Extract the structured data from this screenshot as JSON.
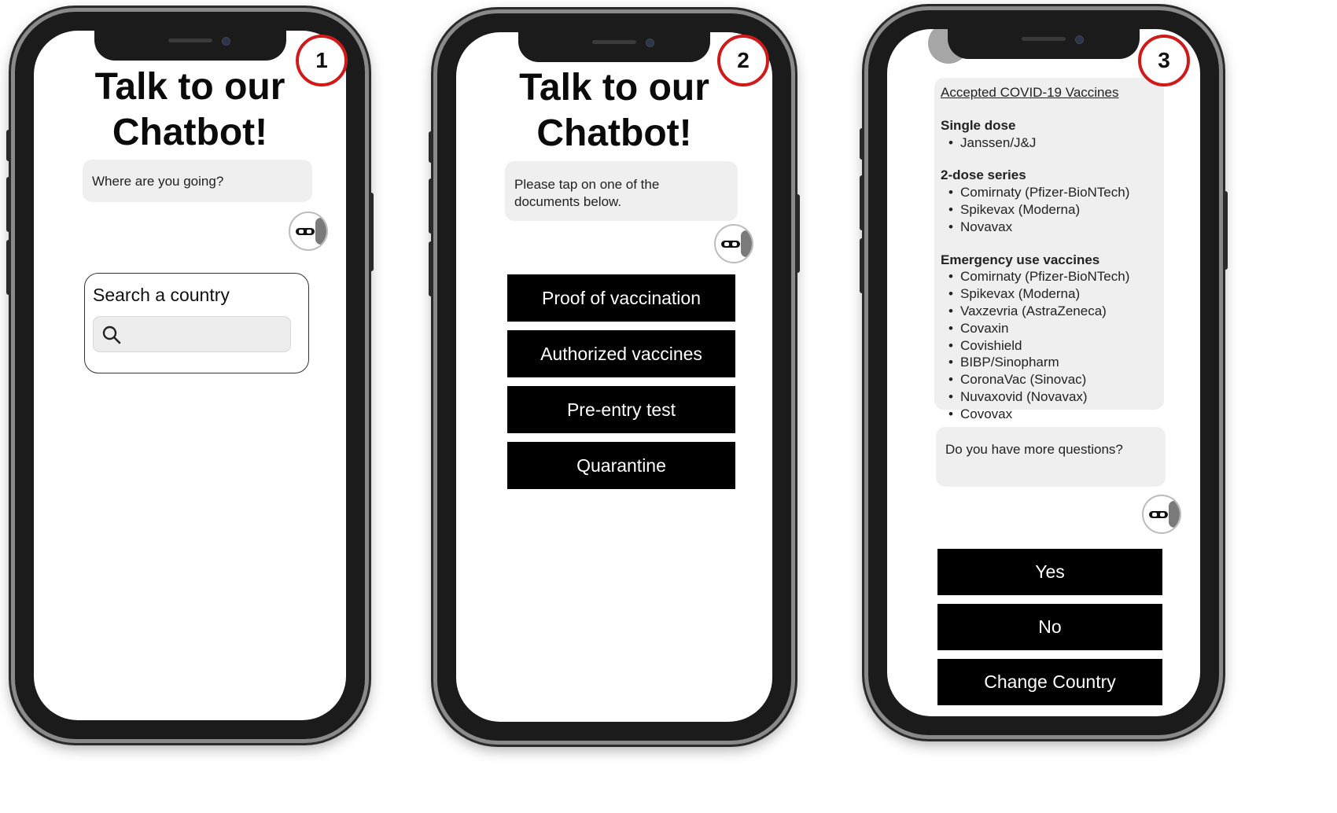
{
  "screens": [
    {
      "step_number": "1",
      "title_line1": "Talk to our",
      "title_line2": "Chatbot!",
      "bot_message": "Where are you going?",
      "search_label": "Search a country",
      "search_placeholder": "",
      "search_icon": "search-icon"
    },
    {
      "step_number": "2",
      "title_line1": "Talk to our",
      "title_line2": "Chatbot!",
      "bot_message": "Please tap on one of the documents below.",
      "options": [
        "Proof of vaccination",
        "Authorized vaccines",
        "Pre-entry test",
        "Quarantine"
      ]
    },
    {
      "step_number": "3",
      "vaccines_heading": "Accepted COVID-19 Vaccines",
      "sections": [
        {
          "title": "Single dose",
          "items": [
            "Janssen/J&J"
          ]
        },
        {
          "title": "2-dose series",
          "items": [
            "Comirnaty (Pfizer-BioNTech)",
            "Spikevax (Moderna)",
            "Novavax"
          ]
        },
        {
          "title": "Emergency use vaccines",
          "items": [
            "Comirnaty (Pfizer-BioNTech)",
            "Spikevax (Moderna)",
            "Vaxzevria (AstraZeneca)",
            "Covaxin",
            "Covishield",
            "BIBP/Sinopharm",
            "CoronaVac (Sinovac)",
            "Nuvaxovid (Novavax)",
            "Covovax"
          ]
        }
      ],
      "bot_message": "Do you have more questions?",
      "options": [
        "Yes",
        "No",
        "Change Country"
      ]
    }
  ],
  "colors": {
    "badge_border": "#d01a1a",
    "button_bg": "#000000",
    "bubble_bg": "#efefef"
  }
}
